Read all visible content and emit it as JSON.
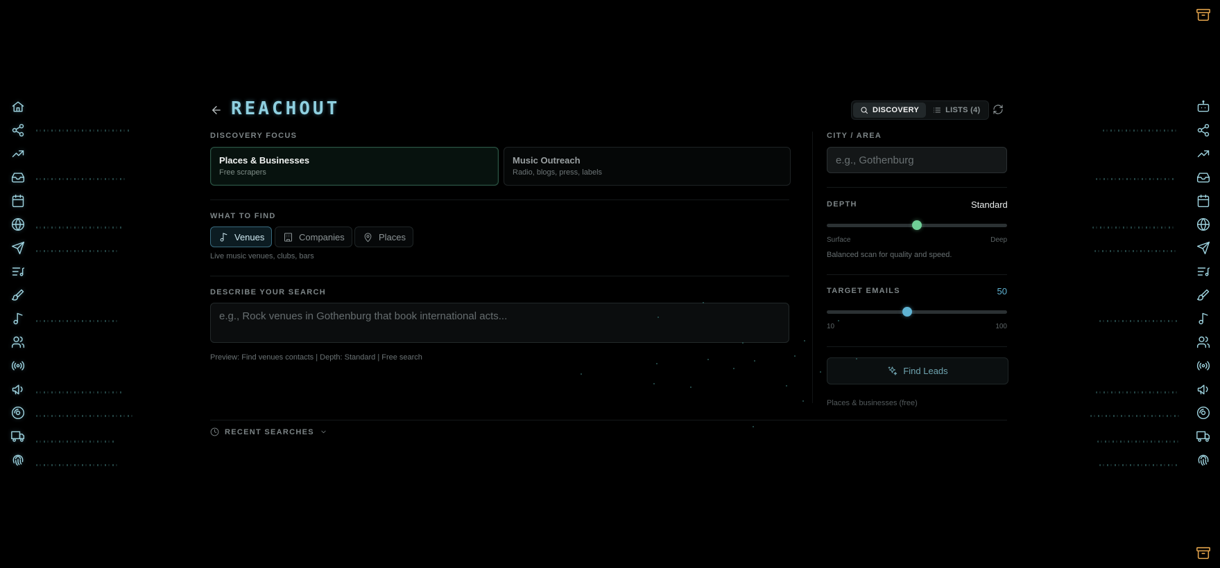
{
  "app": {
    "logo": "REACHOUT"
  },
  "header": {
    "tabs": [
      {
        "label": "DISCOVERY",
        "icon": "search-icon",
        "active": true
      },
      {
        "label": "LISTS (4)",
        "icon": "list-icon",
        "active": false
      }
    ],
    "refresh_icon": "refresh-icon"
  },
  "sidebar_icons": [
    "home",
    "share",
    "trending-up",
    "inbox",
    "calendar",
    "globe",
    "send",
    "list-music",
    "brush",
    "music-note",
    "users",
    "radio",
    "megaphone",
    "disc",
    "truck",
    "fingerprint"
  ],
  "discovery_focus": {
    "label": "DISCOVERY FOCUS",
    "options": [
      {
        "title": "Places & Businesses",
        "subtitle": "Free scrapers",
        "selected": true
      },
      {
        "title": "Music Outreach",
        "subtitle": "Radio, blogs, press, labels",
        "selected": false
      }
    ]
  },
  "what_to_find": {
    "label": "WHAT TO FIND",
    "options": [
      {
        "label": "Venues",
        "icon": "music-note-icon",
        "selected": true
      },
      {
        "label": "Companies",
        "icon": "building-icon",
        "selected": false
      },
      {
        "label": "Places",
        "icon": "map-pin-icon",
        "selected": false
      }
    ],
    "hint": "Live music venues, clubs, bars"
  },
  "describe": {
    "label": "DESCRIBE YOUR SEARCH",
    "placeholder": "e.g., Rock venues in Gothenburg that book international acts...",
    "value": "",
    "preview": "Preview: Find venues contacts | Depth: Standard | Free search"
  },
  "city": {
    "label": "CITY / AREA",
    "placeholder": "e.g., Gothenburg",
    "value": ""
  },
  "depth": {
    "label": "DEPTH",
    "value": "Standard",
    "level": 0.5,
    "min_label": "Surface",
    "max_label": "Deep",
    "description": "Balanced scan for quality and speed."
  },
  "target_emails": {
    "label": "TARGET EMAILS",
    "value": "50",
    "min": 10,
    "max": 100,
    "min_label": "10",
    "max_label": "100"
  },
  "find_button": {
    "label": "Find Leads",
    "icon": "sparkles-icon"
  },
  "find_note": "Places & businesses (free)",
  "recent": {
    "label": "RECENT SEARCHES",
    "icon": "clock-icon"
  },
  "colors": {
    "accent_teal": "#8fd0e0",
    "accent_green": "#6fcf97",
    "accent_blue": "#5fb3d3",
    "corner_orange": "#e2a34b",
    "background": "#000000"
  }
}
